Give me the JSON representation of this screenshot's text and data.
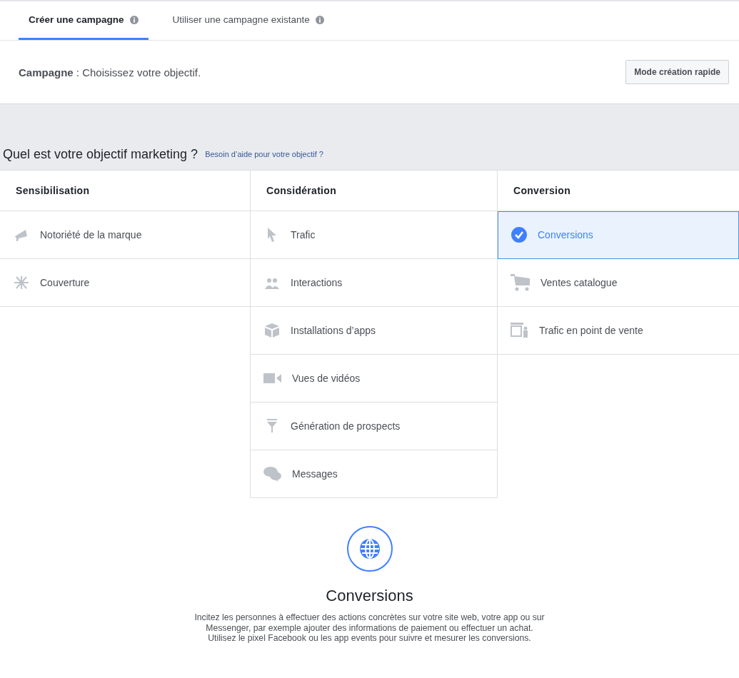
{
  "tabs": [
    {
      "label": "Créer une campagne",
      "selected": true
    },
    {
      "label": "Utiliser une campagne existante",
      "selected": false
    }
  ],
  "header": {
    "label": "Campagne",
    "text": " : Choisissez votre objectif.",
    "button": "Mode création rapide"
  },
  "question": {
    "title": "Quel est votre objectif marketing ?",
    "help_link": "Besoin d’aide pour votre objectif ?"
  },
  "columns": [
    {
      "title": "Sensibilisation",
      "items": [
        {
          "label": "Notoriété de la marque",
          "selected": false
        },
        {
          "label": "Couverture",
          "selected": false
        }
      ]
    },
    {
      "title": "Considération",
      "items": [
        {
          "label": "Trafic",
          "selected": false
        },
        {
          "label": "Interactions",
          "selected": false
        },
        {
          "label": "Installations d’apps",
          "selected": false
        },
        {
          "label": "Vues de vidéos",
          "selected": false
        },
        {
          "label": "Génération de prospects",
          "selected": false
        },
        {
          "label": "Messages",
          "selected": false
        }
      ]
    },
    {
      "title": "Conversion",
      "items": [
        {
          "label": "Conversions",
          "selected": true
        },
        {
          "label": "Ventes catalogue",
          "selected": false
        },
        {
          "label": "Trafic en point de vente",
          "selected": false
        }
      ]
    }
  ],
  "detail": {
    "title": "Conversions",
    "description": "Incitez les personnes à effectuer des actions concrètes sur votre site web, votre app ou sur Messenger, par exemple ajouter des informations de paiement ou effectuer un achat. Utilisez le pixel Facebook ou les app events pour suivre et mesurer les conversions."
  }
}
